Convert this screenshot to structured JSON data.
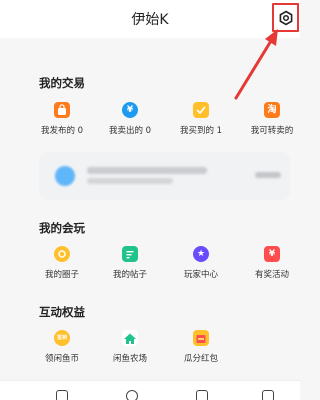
{
  "header": {
    "title": "伊始K",
    "settings_icon": "settings-icon"
  },
  "colors": {
    "annotation": "#e53935",
    "orange": "#ff7a1a",
    "blue": "#1e9bf0",
    "yellow": "#ffc02b",
    "red": "#ff4d4f",
    "green": "#20c48a",
    "purple": "#6a4cff"
  },
  "trade": {
    "title": "我的交易",
    "items": [
      {
        "label": "我发布的 0",
        "icon": "bag-icon",
        "glyph": ""
      },
      {
        "label": "我卖出的 0",
        "icon": "yen-icon",
        "glyph": "¥"
      },
      {
        "label": "我买到的 1",
        "icon": "check-doc-icon",
        "glyph": ""
      },
      {
        "label": "我可转卖的",
        "icon": "taobao-icon",
        "glyph": "淘"
      }
    ]
  },
  "play": {
    "title": "我的会玩",
    "items": [
      {
        "label": "我的圈子",
        "icon": "circle-icon",
        "glyph": ""
      },
      {
        "label": "我的帖子",
        "icon": "post-icon",
        "glyph": ""
      },
      {
        "label": "玩家中心",
        "icon": "star-icon",
        "glyph": "★"
      },
      {
        "label": "有奖活动",
        "icon": "prize-yen-icon",
        "glyph": "¥"
      }
    ]
  },
  "rights": {
    "title": "互动权益",
    "items": [
      {
        "label": "领闲鱼币",
        "icon": "coin-icon",
        "glyph": "签到"
      },
      {
        "label": "闲鱼农场",
        "icon": "farm-icon",
        "glyph": ""
      },
      {
        "label": "瓜分红包",
        "icon": "red-packet-icon",
        "glyph": ""
      }
    ]
  }
}
